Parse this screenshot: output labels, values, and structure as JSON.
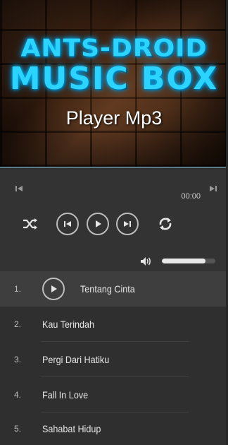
{
  "banner": {
    "logo_line1": "ANTS-DROID",
    "logo_line2": "MUSIC BOX",
    "subtitle": "Player Mp3"
  },
  "player": {
    "time": "00:00",
    "volume_level": 0.82,
    "icons": {
      "prev_small": "skip-previous-icon",
      "next_small": "skip-next-icon",
      "shuffle": "shuffle-icon",
      "previous": "previous-icon",
      "play": "play-icon",
      "next": "next-icon",
      "repeat": "repeat-icon",
      "volume": "volume-icon"
    }
  },
  "playlist": {
    "tracks": [
      {
        "number": "1.",
        "title": "Tentang Cinta",
        "active": true
      },
      {
        "number": "2.",
        "title": "Kau Terindah",
        "active": false
      },
      {
        "number": "3.",
        "title": "Pergi Dari Hatiku",
        "active": false
      },
      {
        "number": "4.",
        "title": "Fall In Love",
        "active": false
      },
      {
        "number": "5.",
        "title": "Sahabat Hidup",
        "active": false
      }
    ]
  },
  "colors": {
    "background": "#2f2f2f",
    "logo_accent": "#2ad4ff",
    "active_row": "#3e3e3e"
  }
}
